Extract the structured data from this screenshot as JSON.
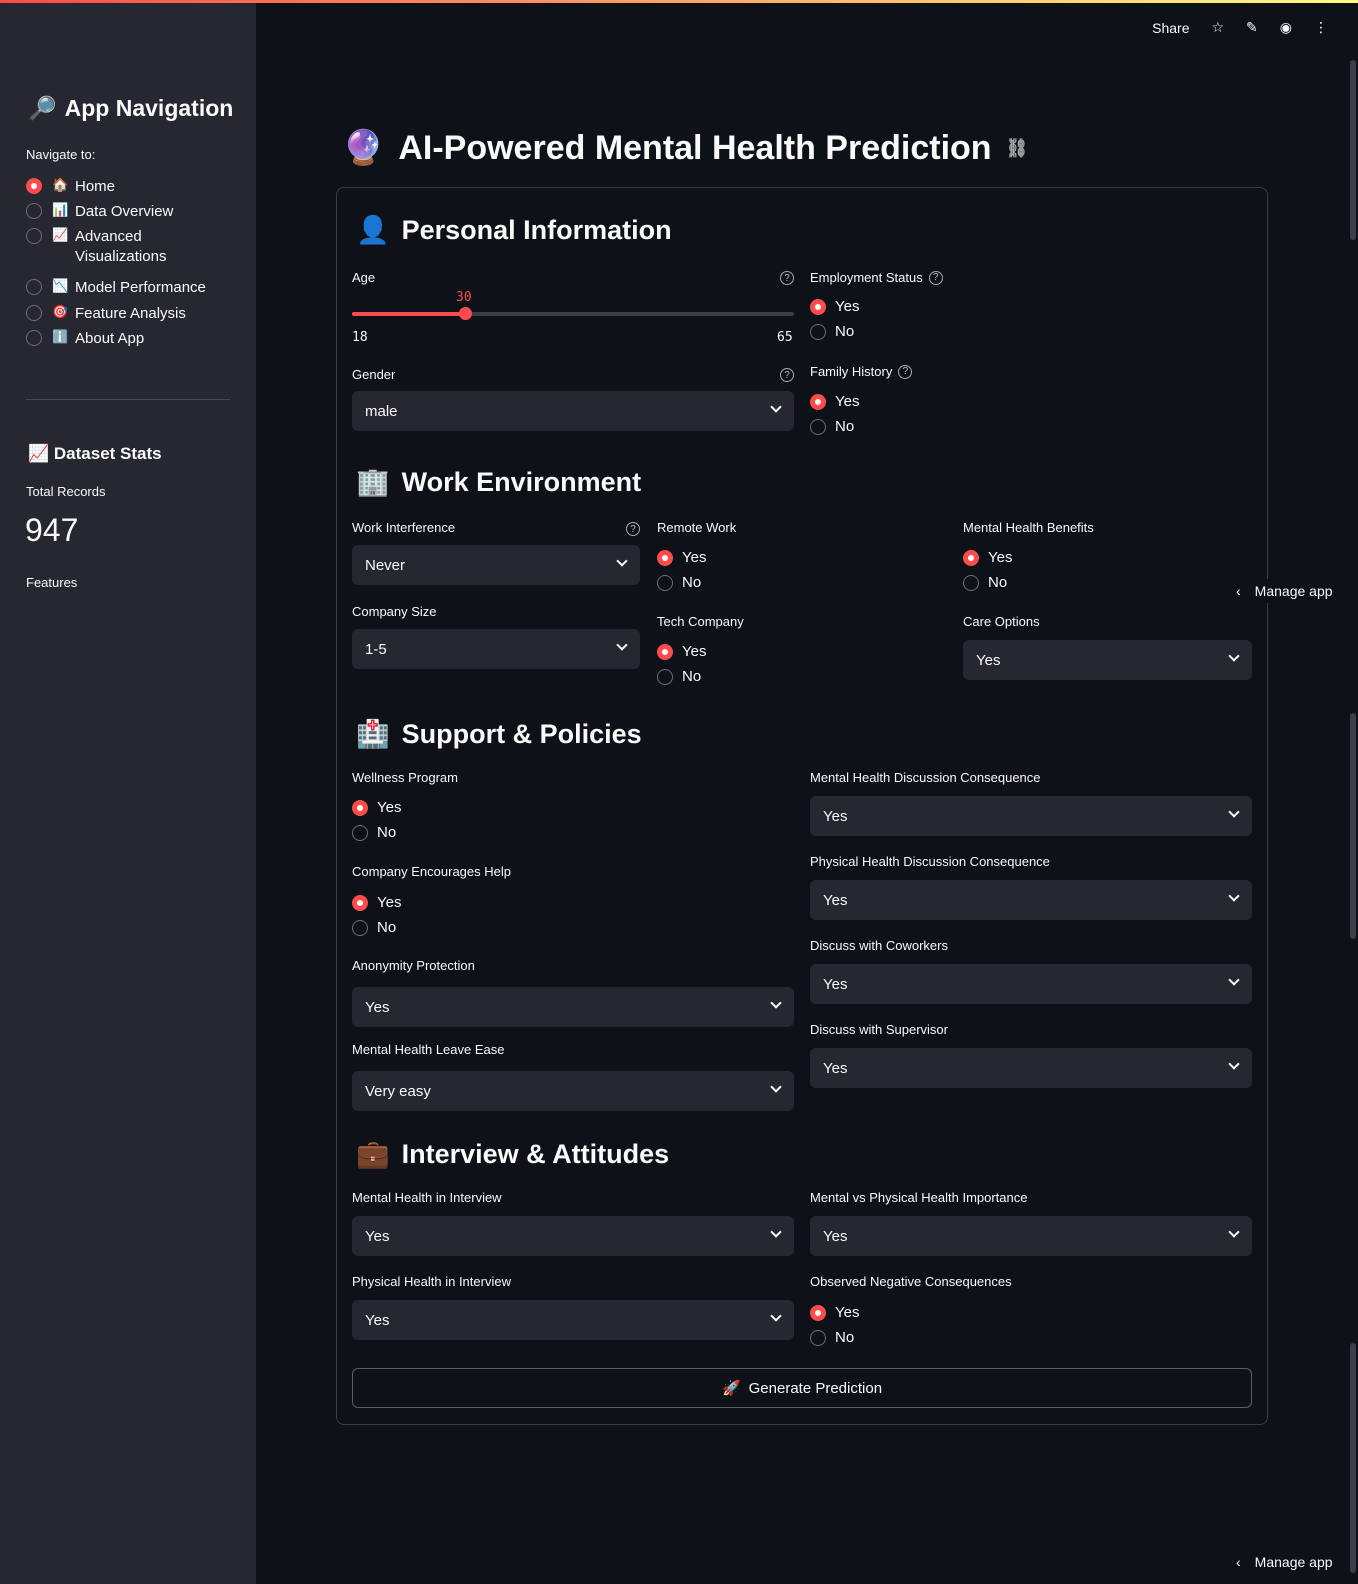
{
  "header": {
    "share_label": "Share"
  },
  "sidebar": {
    "title": "App Navigation",
    "title_icon": "🔎",
    "navigate_label": "Navigate to:",
    "items": [
      {
        "icon": "🏠",
        "label": "Home",
        "selected": true
      },
      {
        "icon": "📊",
        "label": "Data Overview",
        "selected": false
      },
      {
        "icon": "📈",
        "label": "Advanced Visualizations",
        "selected": false
      },
      {
        "icon": "📉",
        "label": "Model Performance",
        "selected": false
      },
      {
        "icon": "🎯",
        "label": "Feature Analysis",
        "selected": false
      },
      {
        "icon": "ℹ️",
        "label": "About App",
        "selected": false
      }
    ],
    "stats_title": "📈 Dataset Stats",
    "total_records_label": "Total Records",
    "total_records_value": "947",
    "features_label": "Features"
  },
  "main": {
    "title": "AI-Powered Mental Health Prediction",
    "title_icon": "🔮",
    "sections": {
      "personal": {
        "icon": "👤",
        "title": "Personal Information"
      },
      "work": {
        "icon": "🏢",
        "title": "Work Environment"
      },
      "support": {
        "icon": "🏥",
        "title": "Support & Policies"
      },
      "interview": {
        "icon": "💼",
        "title": "Interview & Attitudes"
      }
    },
    "age": {
      "label": "Age",
      "value": "30",
      "min": "18",
      "max": "65",
      "fraction": 0.255
    },
    "gender": {
      "label": "Gender",
      "value": "male"
    },
    "employment": {
      "label": "Employment Status",
      "yes": "Yes",
      "no": "No",
      "selected": "Yes"
    },
    "family_history": {
      "label": "Family History",
      "yes": "Yes",
      "no": "No",
      "selected": "Yes"
    },
    "work_interference": {
      "label": "Work Interference",
      "value": "Never"
    },
    "remote_work": {
      "label": "Remote Work",
      "yes": "Yes",
      "no": "No"
    },
    "mh_benefits": {
      "label": "Mental Health Benefits",
      "yes": "Yes",
      "no": "No"
    },
    "company_size": {
      "label": "Company Size",
      "value": "1-5"
    },
    "tech_company": {
      "label": "Tech Company",
      "yes": "Yes",
      "no": "No"
    },
    "care_options": {
      "label": "Care Options",
      "value": "Yes"
    },
    "wellness": {
      "label": "Wellness Program",
      "yes": "Yes",
      "no": "No"
    },
    "encourages_help": {
      "label": "Company Encourages Help",
      "yes": "Yes",
      "no": "No"
    },
    "anonymity": {
      "label": "Anonymity Protection",
      "value": "Yes"
    },
    "leave": {
      "label": "Mental Health Leave Ease",
      "value": "Very easy"
    },
    "mh_consequence": {
      "label": "Mental Health Discussion Consequence",
      "value": "Yes"
    },
    "ph_consequence": {
      "label": "Physical Health Discussion Consequence",
      "value": "Yes"
    },
    "coworkers": {
      "label": "Discuss with Coworkers",
      "value": "Yes"
    },
    "supervisor": {
      "label": "Discuss with Supervisor",
      "value": "Yes"
    },
    "mh_interview": {
      "label": "Mental Health in Interview",
      "value": "Yes"
    },
    "ph_interview": {
      "label": "Physical Health in Interview",
      "value": "Yes"
    },
    "mvp": {
      "label": "Mental vs Physical Health Importance",
      "value": "Yes"
    },
    "obs_consequence": {
      "label": "Observed Negative Consequences",
      "yes": "Yes",
      "no": "No"
    },
    "generate_label": "Generate Prediction",
    "generate_icon": "🚀"
  },
  "manage_app_label": "Manage app"
}
